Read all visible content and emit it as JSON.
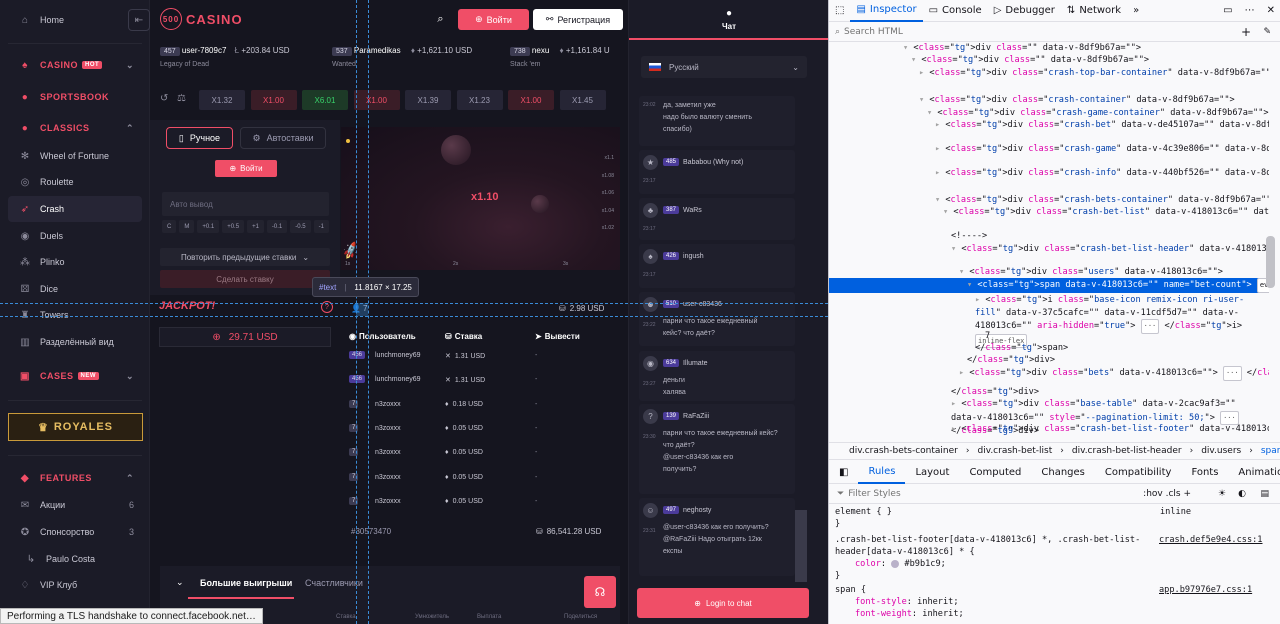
{
  "sidebar": {
    "home": "Home",
    "casino": "CASINO",
    "casino_badge": "HOT",
    "sportsbook": "SPORTSBOOK",
    "classics": "CLASSICS",
    "classic_items": [
      "Wheel of Fortune",
      "Roulette",
      "Crash",
      "Duels",
      "Plinko",
      "Dice",
      "Towers",
      "Разделённый вид"
    ],
    "cases": "CASES",
    "cases_badge": "NEW",
    "royales": "ROYALES",
    "features": "FEATURES",
    "feature_items": [
      {
        "label": "Акции",
        "count": "6"
      },
      {
        "label": "Спонсорство",
        "count": "3"
      },
      {
        "label": "Paulo Costa",
        "count": ""
      },
      {
        "label": "VIP Клуб",
        "count": ""
      }
    ]
  },
  "header": {
    "logo_num": "500",
    "logo_text": "CASINO",
    "login": "Войти",
    "register": "Регистрация"
  },
  "ticker": [
    {
      "level": "457",
      "user": "user-7809c7",
      "amount": "+203.84 USD",
      "game": "Legacy of Dead"
    },
    {
      "level": "537",
      "user": "Paramedikas",
      "amount": "+1,621.10 USD",
      "game": "Wanted"
    },
    {
      "level": "738",
      "user": "nexu",
      "amount": "+1,161.84 U",
      "game": "Stack 'em"
    }
  ],
  "multipliers": [
    {
      "v": "X1.32",
      "c": "low"
    },
    {
      "v": "X1.00",
      "c": "red"
    },
    {
      "v": "X6.01",
      "c": "green"
    },
    {
      "v": "X1.00",
      "c": "red"
    },
    {
      "v": "X1.39",
      "c": "low"
    },
    {
      "v": "X1.23",
      "c": "low"
    },
    {
      "v": "X1.00",
      "c": "red"
    },
    {
      "v": "X1.45",
      "c": "low"
    }
  ],
  "bet_panel": {
    "manual": "Ручное",
    "auto": "Автоставки",
    "login": "Войти",
    "auto_cashout": "Авто вывод",
    "chips": [
      "C",
      "M",
      "+0.1",
      "+0.5",
      "+1",
      "-0.1",
      "-0.5",
      "-1"
    ],
    "repeat": "Повторить предыдущие ставки",
    "place": "Сделать ставку"
  },
  "game": {
    "multiplier": "x1.10",
    "y_ticks": [
      "x1.1",
      "x1.08",
      "x1.06",
      "x1.04",
      "x1.02"
    ],
    "x_ticks": [
      "1s",
      "2s",
      "3s"
    ]
  },
  "jackpot": {
    "title": "JACKPOT!",
    "amount": "29.71 USD"
  },
  "bets": {
    "count": "7",
    "total_top": "2.98 USD",
    "col_user": "Пользователь",
    "col_bet": "Ставка",
    "col_withdraw": "Вывести",
    "rows": [
      {
        "level": "456",
        "user": "lunchmoney69",
        "bet": "1.31 USD",
        "out": "-"
      },
      {
        "level": "456",
        "user": "lunchmoney69",
        "bet": "1.31 USD",
        "out": "-"
      },
      {
        "level": "7",
        "user": "n3zoxxx",
        "bet": "0.18 USD",
        "out": "-"
      },
      {
        "level": "7",
        "user": "n3zoxxx",
        "bet": "0.05 USD",
        "out": "-"
      },
      {
        "level": "7",
        "user": "n3zoxxx",
        "bet": "0.05 USD",
        "out": "-"
      },
      {
        "level": "7",
        "user": "n3zoxxx",
        "bet": "0.05 USD",
        "out": "-"
      },
      {
        "level": "7",
        "user": "n3zoxxx",
        "bet": "0.05 USD",
        "out": "-"
      }
    ],
    "round_id": "#30573470",
    "total": "86,541.28 USD"
  },
  "bottom": {
    "tab_big": "Большие выигрыши",
    "tab_lucky": "Счастливчики",
    "cols": [
      "Ставка",
      "Умножитель",
      "Выплата",
      "Поделиться"
    ]
  },
  "chat": {
    "title": "Чат",
    "language": "Русский",
    "messages": [
      {
        "time": "23:02",
        "user": "",
        "level": "",
        "text": [
          "да, заметил уже",
          "надо было валюту сменить",
          "спасибо)"
        ]
      },
      {
        "time": "23:17",
        "user": "Bababou (Why not)",
        "level": "485",
        "text": []
      },
      {
        "time": "23:17",
        "user": "WaRs",
        "level": "387",
        "text": []
      },
      {
        "time": "23:17",
        "user": "ingush",
        "level": "426",
        "text": []
      },
      {
        "time": "23:22",
        "user": "user-c83436",
        "level": "510",
        "text": [
          "парни что такое ежедневный",
          "кейс? что даёт?"
        ]
      },
      {
        "time": "23:27",
        "user": "Illumate",
        "level": "634",
        "text": [
          "деньги",
          "халява"
        ]
      },
      {
        "time": "23:30",
        "user": "RaFaZiii",
        "level": "139",
        "text": [
          "парни что такое ежедневный кейс?",
          "что даёт?",
          "@user-c83436 как его",
          "получить?"
        ]
      },
      {
        "time": "23:31",
        "user": "neghosty",
        "level": "497",
        "text": [
          "@user-c83436 как его получить?",
          "@RaFaZiii Надо отыграть 12кк",
          "експы"
        ]
      }
    ],
    "login": "Login to chat"
  },
  "tooltip": {
    "node": "#text",
    "size": "11.8167 × 17.25"
  },
  "status_bar": "Performing a TLS handshake to connect.facebook.net…",
  "devtools": {
    "tabs": [
      "Inspector",
      "Console",
      "Debugger",
      "Network"
    ],
    "search_placeholder": "Search HTML",
    "lines": [
      "<div class=\"\" data-v-8df9b67a=\"\">",
      "<div class=\"\" data-v-8df9b67a=\"\">",
      "<div class=\"crash-top-bar-container\" data-v-8df9b67a=\"\"> ··· </div>",
      "<div class=\"crash-container\" data-v-8df9b67a=\"\">",
      "<div class=\"crash-game-container\" data-v-8df9b67a=\"\"> grid",
      "<div class=\"crash-bet\" data-v-de45107a=\"\" data-v-8df9b67a=\"\"> ··· </div>",
      "<div class=\"crash-game\" data-v-4c39e806=\"\" data-v-8df9b67a=\"\"> ··· </div>",
      "<div class=\"crash-info\" data-v-440bf526=\"\" data-v-8df9b67a=\"\"> ··· </div> grid",
      "<div class=\"crash-bets-container\" data-v-8df9b67a=\"\">",
      "<div class=\"crash-bet-list\" data-v-418013c6=\"\" data-v-8df9b67a=\"\">",
      "<!---->",
      "<div class=\"crash-bet-list-header\" data-v-418013c6=\"\"> flex",
      "<div class=\"users\" data-v-418013c6=\"\">",
      "<span data-v-418013c6=\"\" name=\"bet-count\"> event",
      "<i class=\"base-icon remix-icon ri-user-fill\" data-v-37c5cafc=\"\" data-v-11cdf5d7=\"\" data-v-418013c6=\"\" aria-hidden=\"true\"> ··· </i> inline-flex",
      "7",
      "</span>",
      "</div>",
      "<div class=\"bets\" data-v-418013c6=\"\"> ··· </div>",
      "</div>",
      "<div class=\"base-table\" data-v-2cac9af3=\"\" data-v-418013c6=\"\" style=\"--pagination-limit: 50;\"> ··· </div>",
      "<div class=\"crash-bet-list-footer\" data-v-418013c6=\"\"> ··· </div>"
    ],
    "breadcrumbs": [
      "div.crash-bets-container",
      "div.crash-bet-list",
      "div.crash-bet-list-header",
      "div.users",
      "span"
    ],
    "rule_tabs": [
      "Rules",
      "Layout",
      "Computed",
      "Changes",
      "Compatibility",
      "Fonts",
      "Animations"
    ],
    "filter_placeholder": "Filter Styles",
    "filter_tools": ":hov  .cls  +",
    "rules": [
      {
        "sel": "element { }",
        "src": "inline"
      },
      {
        "sel": ".crash-bet-list-footer[data-v-418013c6] *, .crash-bet-list-header[data-v-418013c6] * {",
        "src": "crash.def5e9e4.css:1"
      },
      {
        "prop": "color",
        "val": "#b9b1c9"
      },
      {
        "sel": "span {",
        "src": "app.b97976e7.css:1"
      },
      {
        "prop": "font-style",
        "val": "inherit"
      },
      {
        "prop": "font-weight",
        "val": "inherit"
      }
    ]
  }
}
